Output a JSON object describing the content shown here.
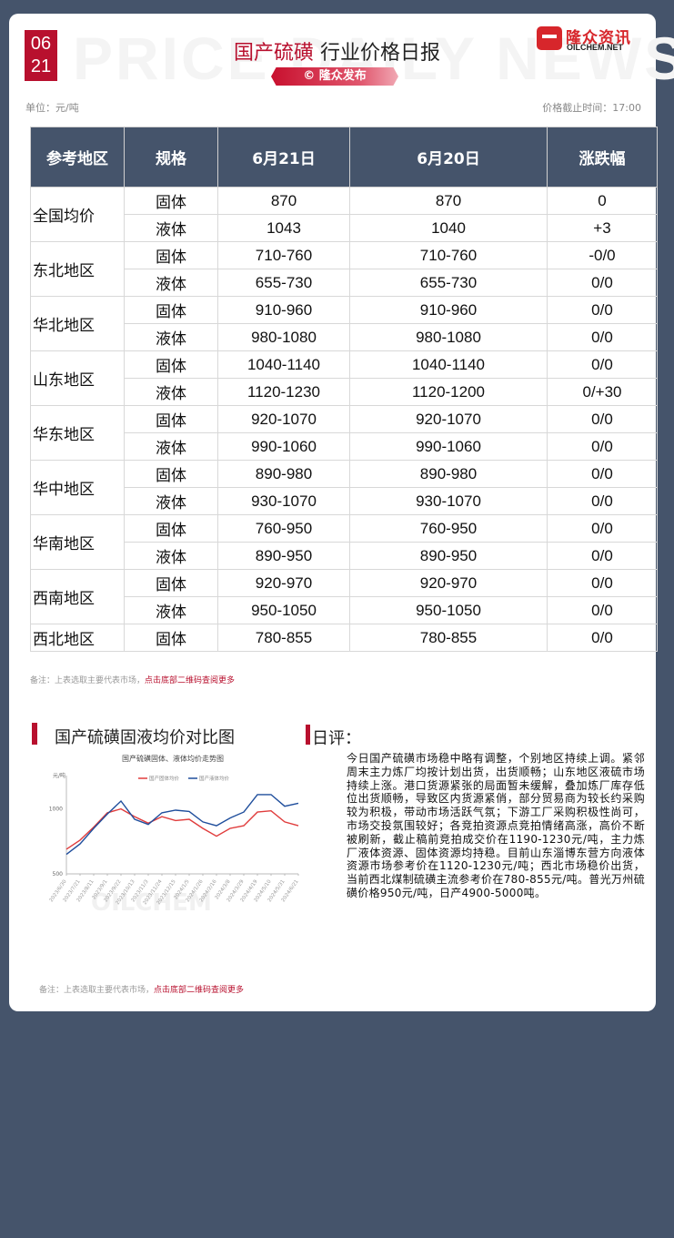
{
  "header": {
    "date_month": "06",
    "date_day": "21",
    "watermark": "PRICE DAILY NEWS",
    "title_highlight": "国产硫磺",
    "title_rest": " 行业价格日报",
    "publisher_badge": "© 隆众发布",
    "logo_cn": "隆众资讯",
    "logo_en": "OILCHEM.NET",
    "unit": "单位：元/吨",
    "cutoff": "价格截止时间：17:00"
  },
  "table": {
    "headers": [
      "参考地区",
      "规格",
      "6月21日",
      "6月20日",
      "涨跌幅"
    ],
    "rows": [
      {
        "region": "全国均价",
        "items": [
          {
            "spec": "固体",
            "today": "870",
            "prev": "870",
            "change": "0"
          },
          {
            "spec": "液体",
            "today": "1043",
            "prev": "1040",
            "change": "+3"
          }
        ]
      },
      {
        "region": "东北地区",
        "items": [
          {
            "spec": "固体",
            "today": "710-760",
            "prev": "710-760",
            "change": "-0/0"
          },
          {
            "spec": "液体",
            "today": "655-730",
            "prev": "655-730",
            "change": "0/0"
          }
        ]
      },
      {
        "region": "华北地区",
        "items": [
          {
            "spec": "固体",
            "today": "910-960",
            "prev": "910-960",
            "change": "0/0"
          },
          {
            "spec": "液体",
            "today": "980-1080",
            "prev": "980-1080",
            "change": "0/0"
          }
        ]
      },
      {
        "region": "山东地区",
        "items": [
          {
            "spec": "固体",
            "today": "1040-1140",
            "prev": "1040-1140",
            "change": "0/0"
          },
          {
            "spec": "液体",
            "today": "1120-1230",
            "prev": "1120-1200",
            "change": "0/+30"
          }
        ]
      },
      {
        "region": "华东地区",
        "items": [
          {
            "spec": "固体",
            "today": "920-1070",
            "prev": "920-1070",
            "change": "0/0"
          },
          {
            "spec": "液体",
            "today": "990-1060",
            "prev": "990-1060",
            "change": "0/0"
          }
        ]
      },
      {
        "region": "华中地区",
        "items": [
          {
            "spec": "固体",
            "today": "890-980",
            "prev": "890-980",
            "change": "0/0"
          },
          {
            "spec": "液体",
            "today": "930-1070",
            "prev": "930-1070",
            "change": "0/0"
          }
        ]
      },
      {
        "region": "华南地区",
        "items": [
          {
            "spec": "固体",
            "today": "760-950",
            "prev": "760-950",
            "change": "0/0"
          },
          {
            "spec": "液体",
            "today": "890-950",
            "prev": "890-950",
            "change": "0/0"
          }
        ]
      },
      {
        "region": "西南地区",
        "items": [
          {
            "spec": "固体",
            "today": "920-970",
            "prev": "920-970",
            "change": "0/0"
          },
          {
            "spec": "液体",
            "today": "950-1050",
            "prev": "950-1050",
            "change": "0/0"
          }
        ]
      },
      {
        "region": "西北地区",
        "items": [
          {
            "spec": "固体",
            "today": "780-855",
            "prev": "780-855",
            "change": "0/0"
          }
        ]
      }
    ]
  },
  "note1": {
    "text": "备注：上表选取主要代表市场，",
    "link": "点击底部二维码查阅更多"
  },
  "chart_section": {
    "title": "国产硫磺固液均价对比图"
  },
  "comment_section": {
    "title": "日评：",
    "body": "今日国产硫磺市场稳中略有调整，个别地区持续上调。紧邻周末主力炼厂均按计划出货，出货顺畅；山东地区液硫市场持续上涨。港口货源紧张的局面暂未缓解，叠加炼厂库存低位出货顺畅，导致区内货源紧俏，部分贸易商为较长约采购较为积极，带动市场活跃气氛；下游工厂采购积极性尚可，市场交投氛围较好；各竞拍资源点竞拍情绪高涨，高价不断被刷新，截止稿前竞拍成交价在1190-1230元/吨，主力炼厂液体资源、固体资源均持稳。目前山东淄博东营方向液体资源市场参考价在1120-1230元/吨；西北市场稳价出货，当前西北煤制硫磺主流参考价在780-855元/吨。普光万州硫磺价格950元/吨，日产4900-5000吨。"
  },
  "note2": {
    "text": "备注：上表选取主要代表市场，",
    "link": "点击底部二维码查阅更多"
  },
  "colors": {
    "accent": "#b8102e",
    "header_bg": "#45546b",
    "solid_line": "#e03c3c",
    "liquid_line": "#1f4e9c"
  },
  "chart_data": {
    "type": "line",
    "title": "国产硫磺固体、液体均价走势图",
    "ylabel": "元/吨",
    "xlabel": "",
    "ylim": [
      500,
      1200
    ],
    "yticks": [
      500,
      1000
    ],
    "watermark": "OILCHEM",
    "x": [
      "2023/6/30",
      "2023/7/21",
      "2023/8/11",
      "2023/9/1",
      "2023/9/22",
      "2023/10/13",
      "2023/11/3",
      "2023/11/24",
      "2023/12/15",
      "2024/1/5",
      "2024/1/26",
      "2024/2/16",
      "2024/3/8",
      "2024/3/29",
      "2024/4/19",
      "2024/5/10",
      "2024/5/31",
      "2024/6/21"
    ],
    "legend": "top-center",
    "series": [
      {
        "name": "国产固体均价",
        "values": [
          690,
          760,
          860,
          970,
          1000,
          940,
          890,
          940,
          910,
          920,
          850,
          790,
          850,
          870,
          975,
          985,
          900,
          870
        ]
      },
      {
        "name": "国产液体均价",
        "values": [
          650,
          730,
          850,
          960,
          1060,
          920,
          880,
          970,
          990,
          980,
          900,
          870,
          930,
          975,
          1110,
          1110,
          1020,
          1043
        ]
      }
    ]
  }
}
